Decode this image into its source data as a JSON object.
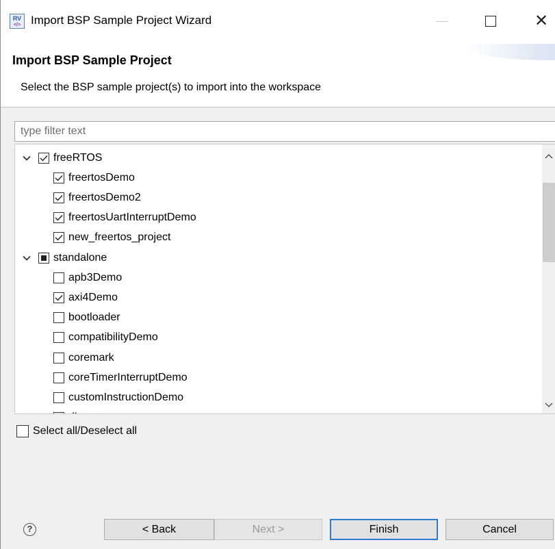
{
  "window": {
    "title": "Import BSP Sample Project Wizard",
    "app_icon_text": "RV"
  },
  "header": {
    "title": "Import BSP Sample Project",
    "description": "Select the BSP sample project(s) to import into the workspace"
  },
  "filter": {
    "placeholder": "type filter text",
    "value": ""
  },
  "tree": {
    "groups": [
      {
        "label": "freeRTOS",
        "state": "checked",
        "expanded": true,
        "items": [
          {
            "label": "freertosDemo",
            "checked": true
          },
          {
            "label": "freertosDemo2",
            "checked": true
          },
          {
            "label": "freertosUartInterruptDemo",
            "checked": true
          },
          {
            "label": "new_freertos_project",
            "checked": true
          }
        ]
      },
      {
        "label": "standalone",
        "state": "partial",
        "expanded": true,
        "items": [
          {
            "label": "apb3Demo",
            "checked": false
          },
          {
            "label": "axi4Demo",
            "checked": true
          },
          {
            "label": "bootloader",
            "checked": false
          },
          {
            "label": "compatibilityDemo",
            "checked": false
          },
          {
            "label": "coremark",
            "checked": false
          },
          {
            "label": "coreTimerInterruptDemo",
            "checked": false
          },
          {
            "label": "customInstructionDemo",
            "checked": false
          },
          {
            "label": "dhrystone",
            "checked": false
          }
        ]
      }
    ]
  },
  "select_all": {
    "label": "Select all/Deselect all",
    "checked": false
  },
  "buttons": {
    "help_glyph": "?",
    "back": "< Back",
    "next": "Next >",
    "finish": "Finish",
    "cancel": "Cancel"
  }
}
